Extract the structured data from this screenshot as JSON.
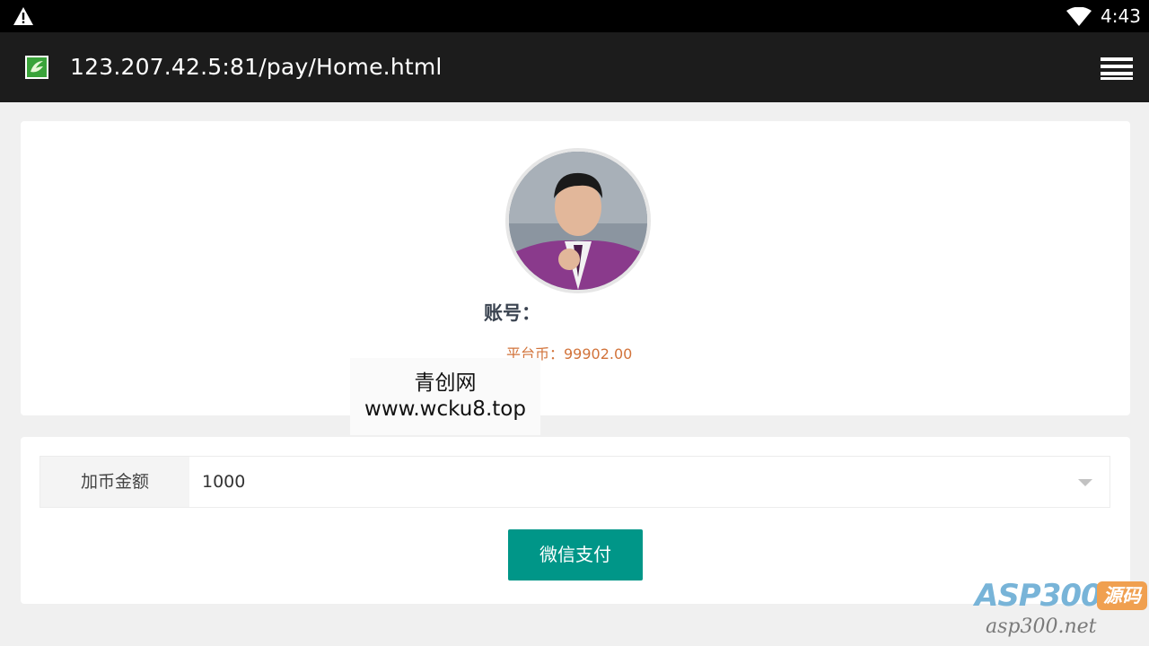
{
  "status_bar": {
    "time": "4:43",
    "icons": [
      "warning-icon",
      "wifi-icon"
    ]
  },
  "browser": {
    "url": "123.207.42.5:81/pay/Home.html",
    "icons": [
      "site-favicon-icon",
      "menu-icon"
    ]
  },
  "profile": {
    "account_label": "账号：",
    "coin_text": "平台币：99902.00"
  },
  "watermark": {
    "title": "青创网",
    "url": "www.wcku8.top"
  },
  "payment": {
    "amount_label": "加币金额",
    "amount_value": "1000",
    "pay_button": "微信支付"
  },
  "brand": {
    "main": "ASP300",
    "tag": "源码",
    "sub": "asp300.net"
  },
  "colors": {
    "accent": "#009688",
    "coin": "#d2733a",
    "topbar": "#1c1c1c"
  }
}
